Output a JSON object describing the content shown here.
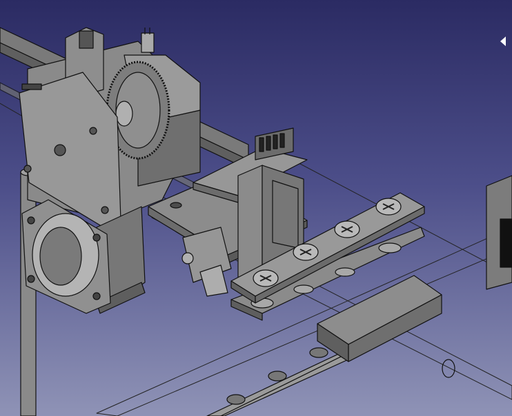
{
  "viewer": {
    "background_top": "#2b2b63",
    "background_bottom": "#8f93b6",
    "model_fill": "#7f7f7f",
    "model_edge": "#111111"
  },
  "controls": {
    "panel_toggle_icon": "triangle-left-icon"
  }
}
